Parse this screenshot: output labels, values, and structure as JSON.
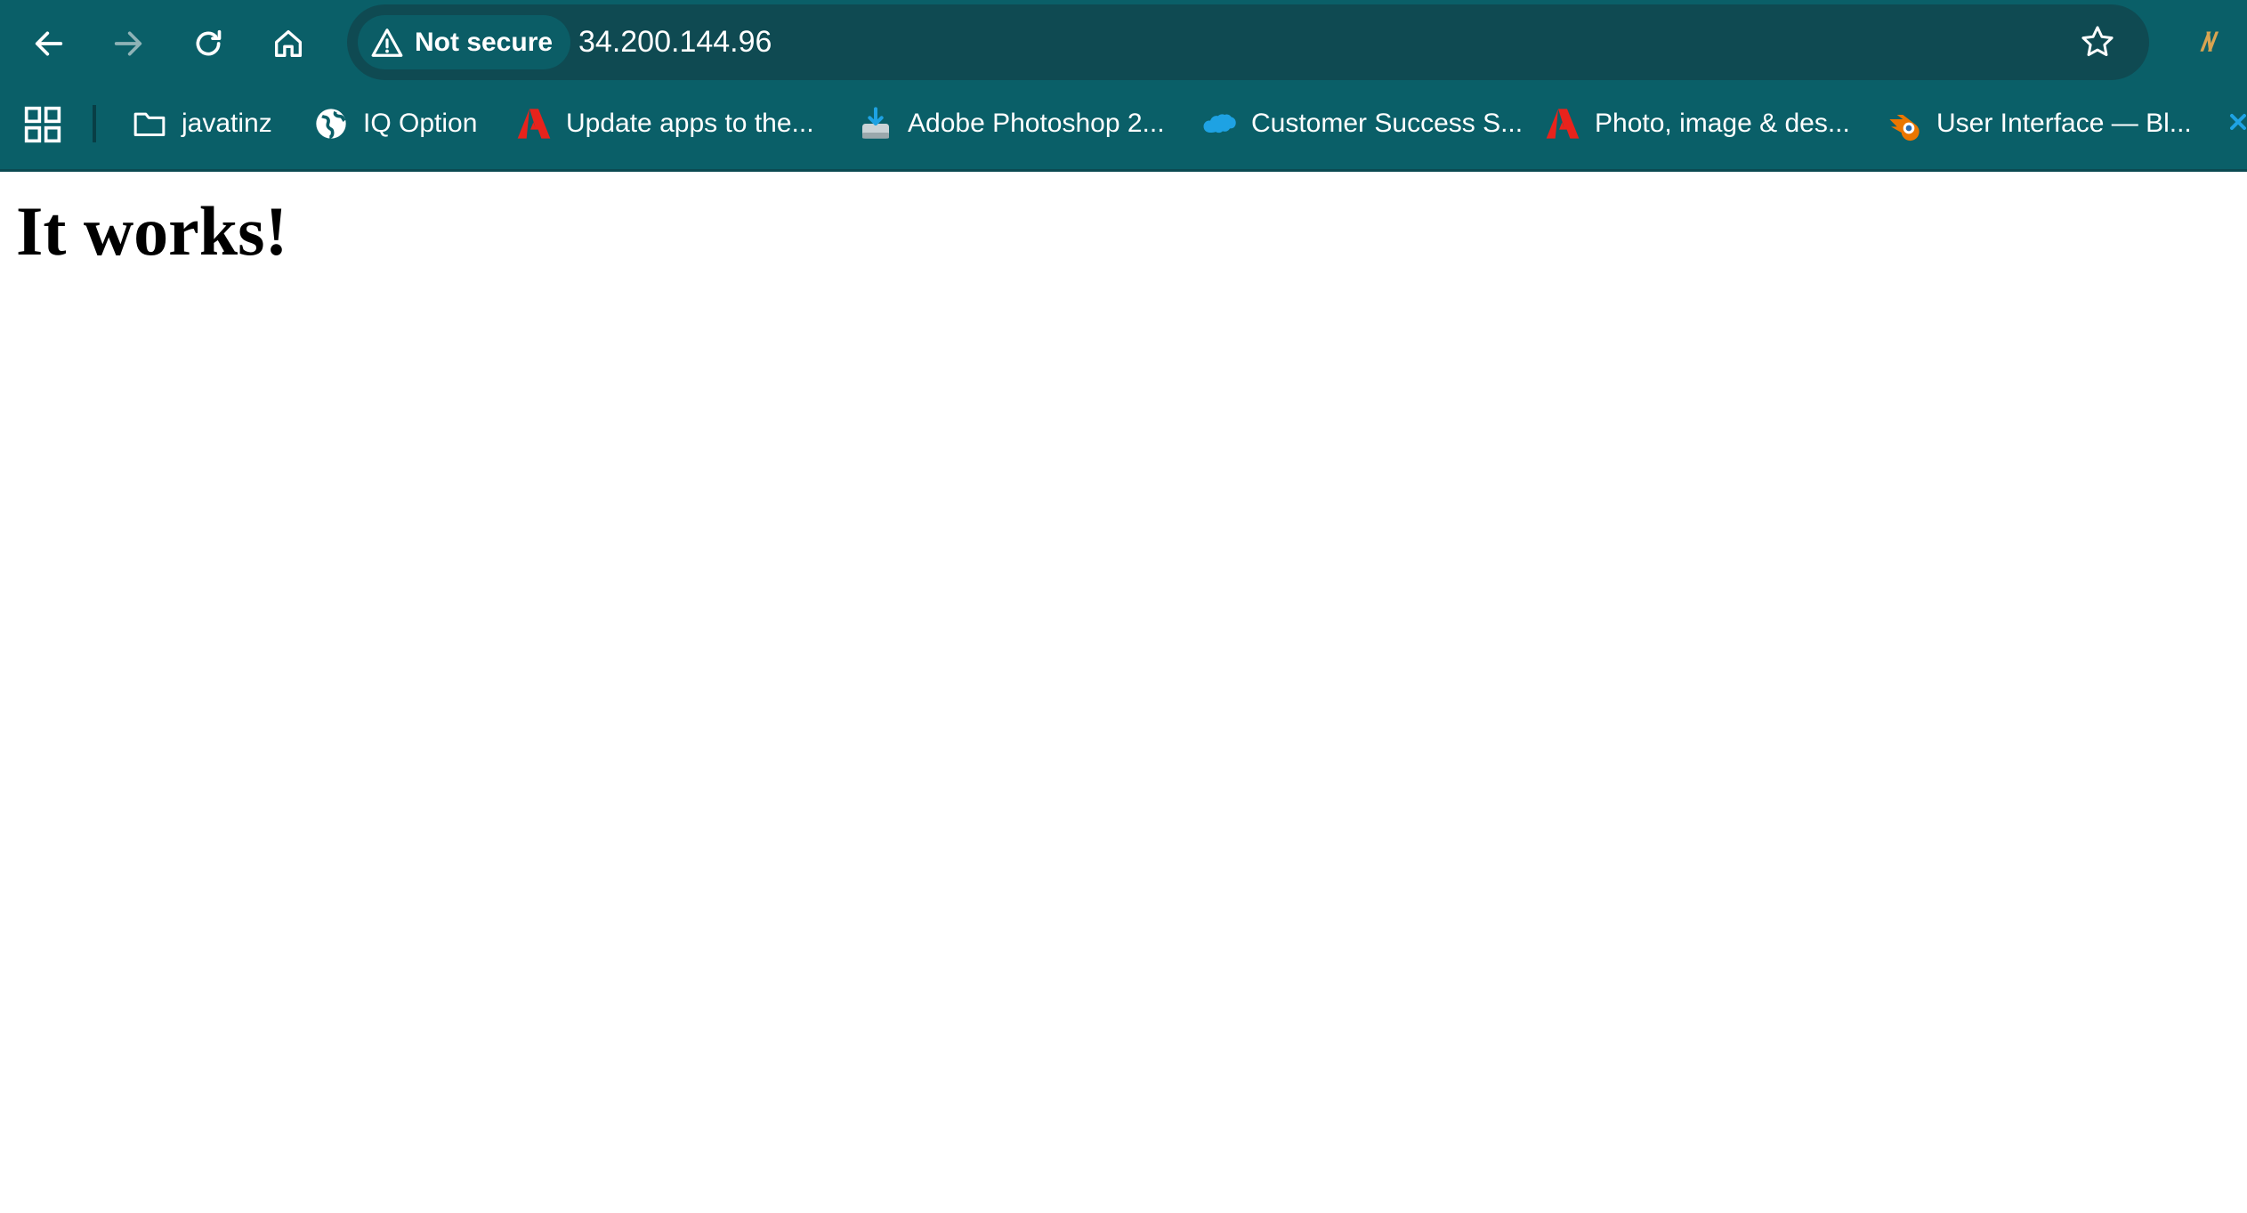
{
  "toolbar": {
    "back_icon": "arrow-left",
    "forward_icon": "arrow-right",
    "reload_icon": "reload",
    "home_icon": "home"
  },
  "omnibox": {
    "security_label": "Not secure",
    "security_icon": "warning-triangle",
    "url": "34.200.144.96",
    "bookmark_star_icon": "star"
  },
  "extension": {
    "label": "/\\/",
    "color": "#d8a451"
  },
  "bookmarks_bar": {
    "apps_icon": "grid",
    "items": [
      {
        "label": "javatinz",
        "icon": "folder"
      },
      {
        "label": "IQ Option",
        "icon": "globe"
      },
      {
        "label": "Update apps to the...",
        "icon": "adobe"
      },
      {
        "label": "Adobe Photoshop 2...",
        "icon": "download-drive"
      },
      {
        "label": "Customer Success S...",
        "icon": "salesforce-cloud"
      },
      {
        "label": "Photo, image & des...",
        "icon": "adobe"
      },
      {
        "label": "User Interface — Bl...",
        "icon": "blender"
      }
    ]
  },
  "page": {
    "heading": "It works!"
  },
  "colors": {
    "chrome_bg": "#0a5f68",
    "omnibox_bg": "#0f4a52",
    "adobe_red": "#e8231c",
    "salesforce_blue": "#1ea2e3",
    "blender_orange": "#ea7600"
  }
}
